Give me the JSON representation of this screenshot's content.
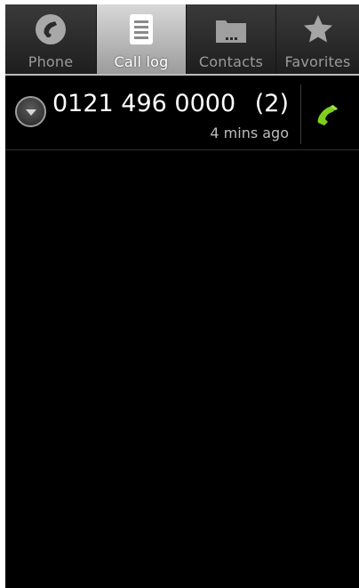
{
  "tabs": [
    {
      "label": "Phone",
      "icon": "phone-icon",
      "active": false
    },
    {
      "label": "Call log",
      "icon": "call-log-icon",
      "active": true
    },
    {
      "label": "Contacts",
      "icon": "contacts-icon",
      "active": false
    },
    {
      "label": "Favorites",
      "icon": "star-icon",
      "active": false
    }
  ],
  "call_log": {
    "entries": [
      {
        "number": "0121 496 0000",
        "count": "(2)",
        "time": "4 mins ago",
        "expander_icon": "chevron-down-icon",
        "call_icon": "phone-icon"
      }
    ]
  },
  "colors": {
    "background": "#000000",
    "active_tab": "#c0c0c0",
    "call_accent": "#7fcf1e"
  }
}
